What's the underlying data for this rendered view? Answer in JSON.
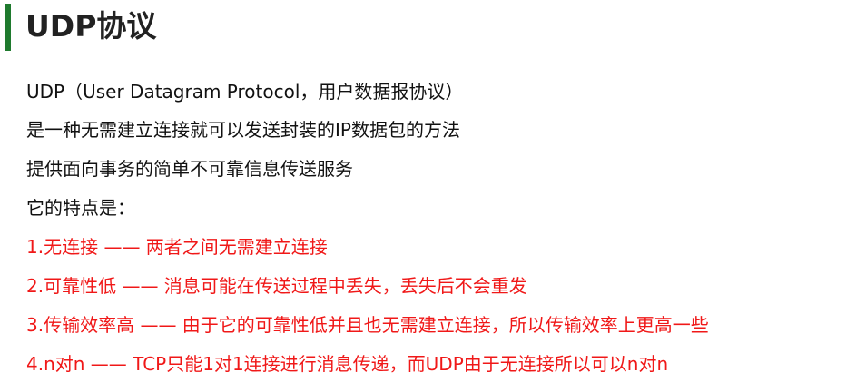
{
  "title": "UDP协议",
  "accent_color": "#1f7a2e",
  "highlight_color": "#f01818",
  "lines": [
    "UDP（User Datagram Protocol，用户数据报协议）",
    "是一种无需建立连接就可以发送封装的IP数据包的方法",
    "提供面向事务的简单不可靠信息传送服务",
    "它的特点是："
  ],
  "features": [
    "1.无连接 —— 两者之间无需建立连接",
    "2.可靠性低 —— 消息可能在传送过程中丢失，丢失后不会重发",
    "3.传输效率高 —— 由于它的可靠性低并且也无需建立连接，所以传输效率上更高一些",
    "4.n对n —— TCP只能1对1连接进行消息传递，而UDP由于无连接所以可以n对n"
  ]
}
